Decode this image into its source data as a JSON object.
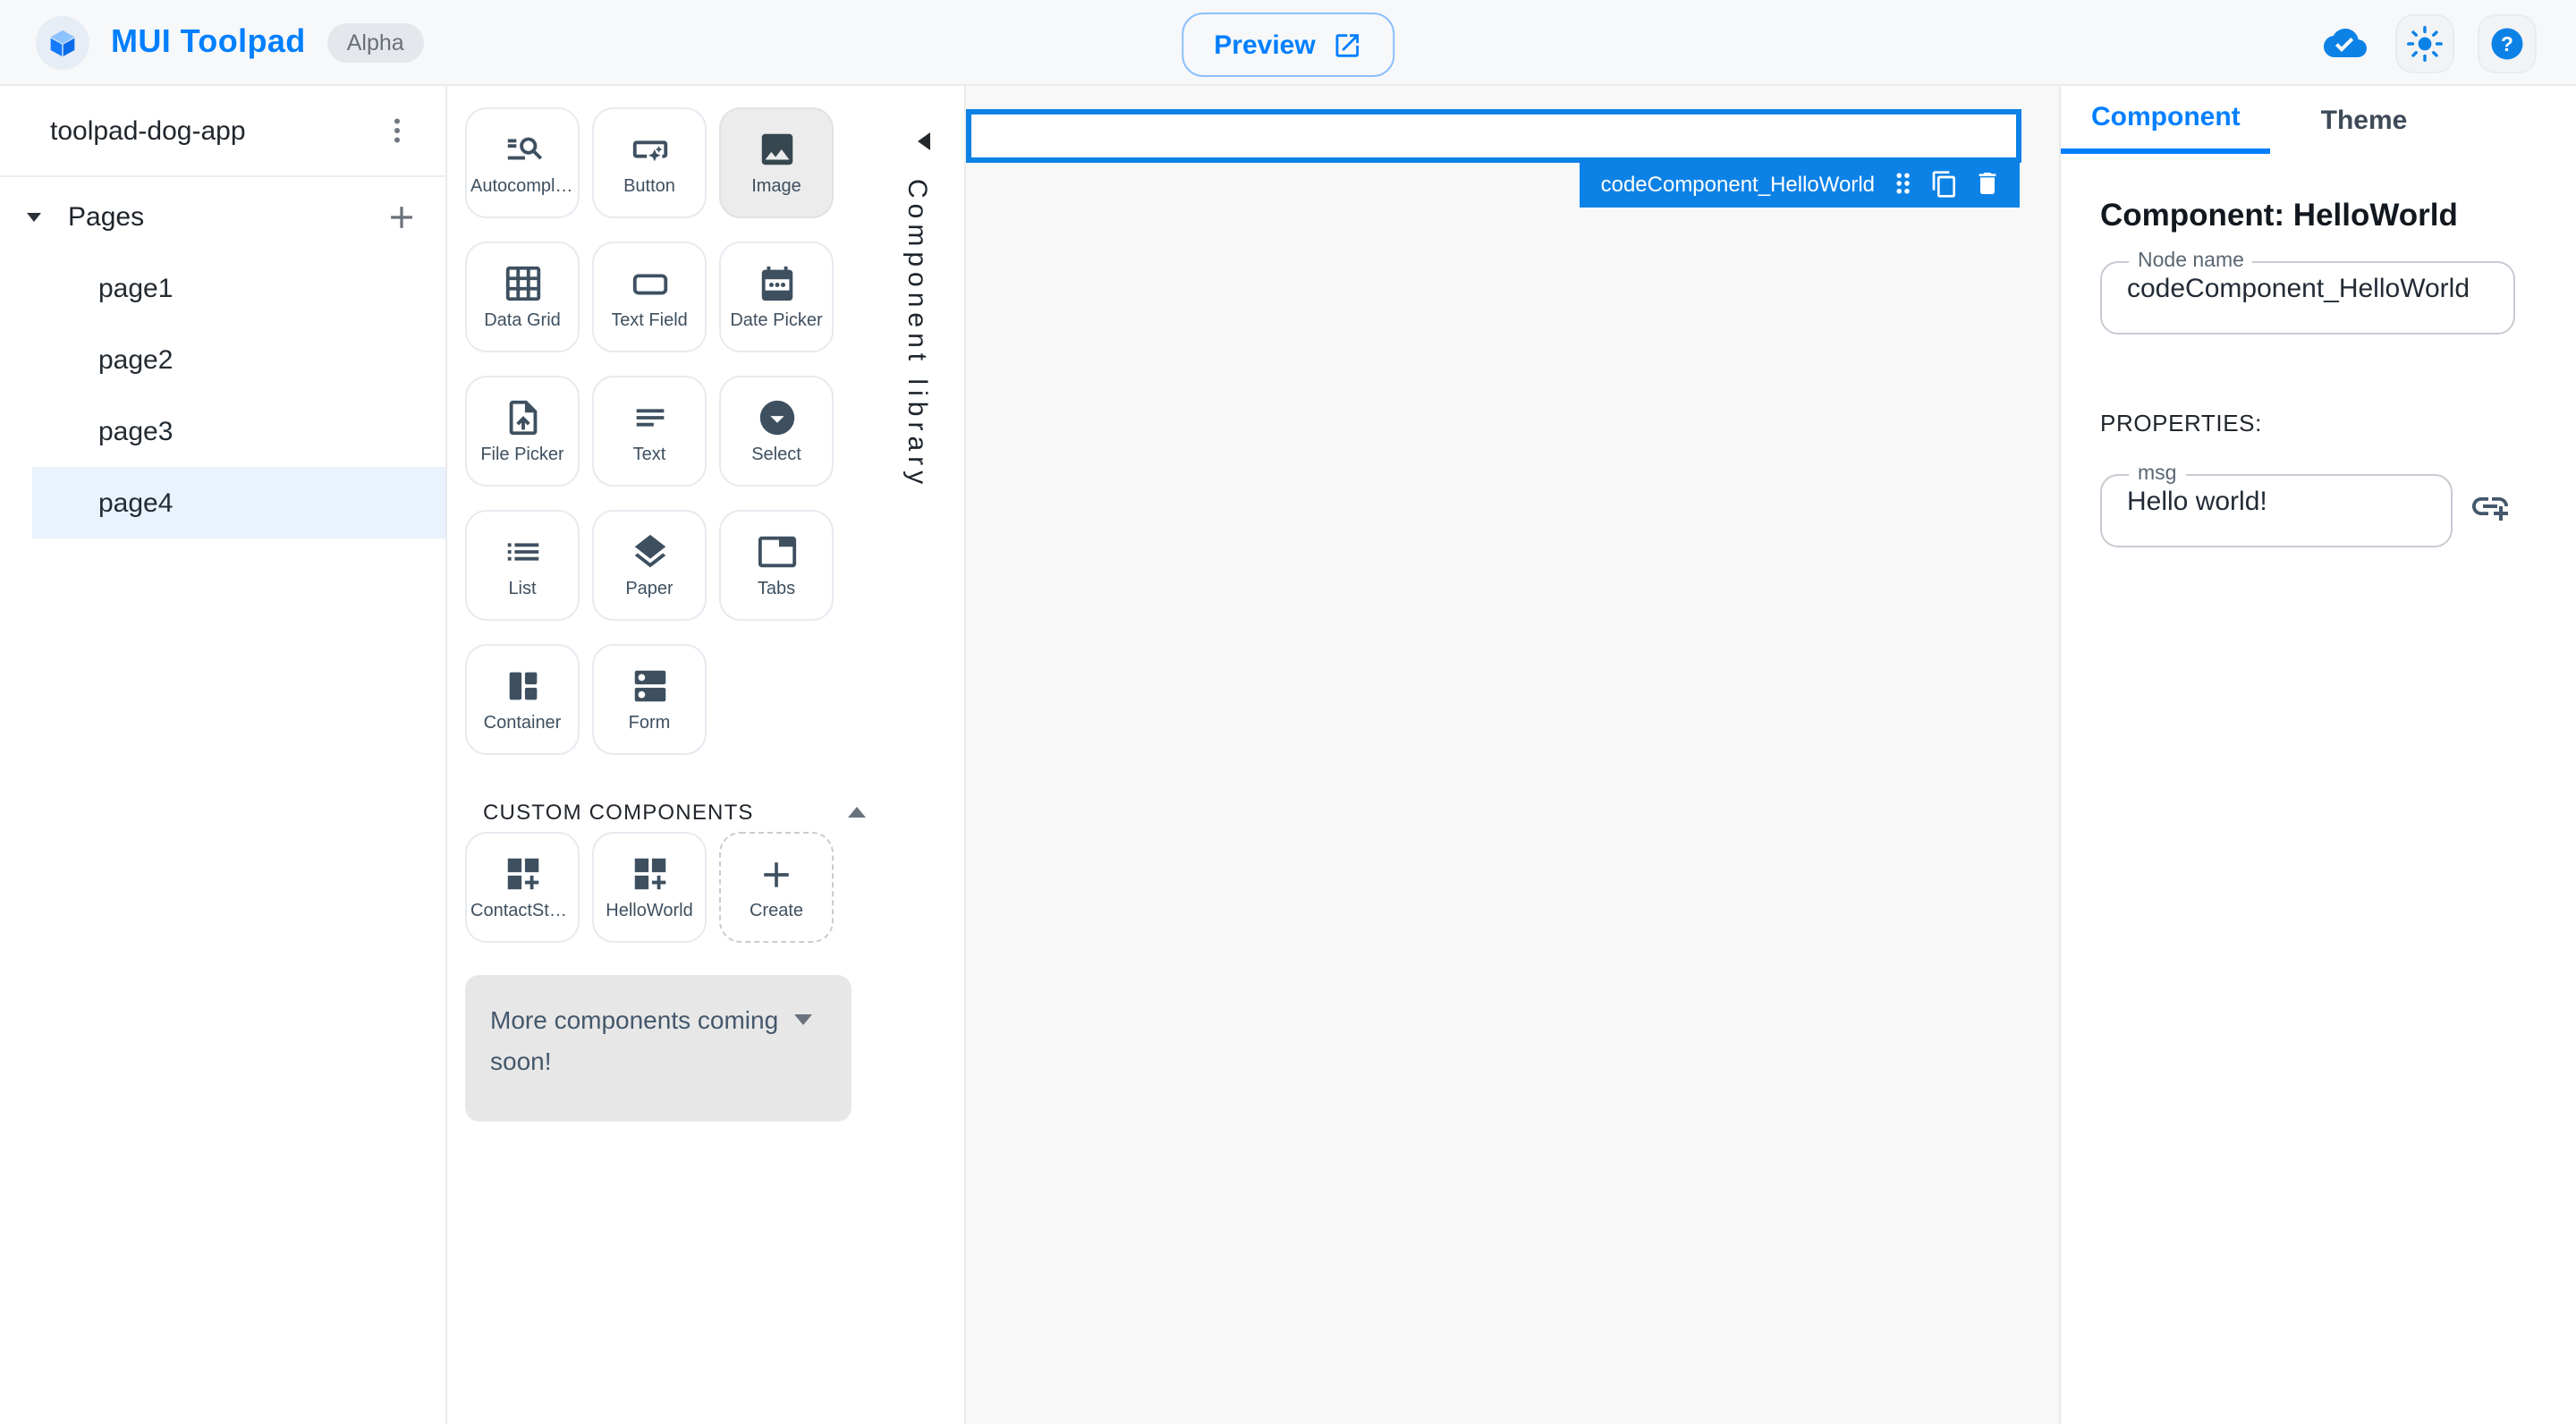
{
  "header": {
    "app_title": "MUI Toolpad",
    "badge": "Alpha",
    "preview_label": "Preview"
  },
  "sidebar": {
    "app_name": "toolpad-dog-app",
    "pages_label": "Pages",
    "pages": [
      {
        "label": "page1",
        "selected": false
      },
      {
        "label": "page2",
        "selected": false
      },
      {
        "label": "page3",
        "selected": false
      },
      {
        "label": "page4",
        "selected": true
      }
    ]
  },
  "library": {
    "panel_label": "Component library",
    "components": [
      {
        "label": "Autocomplete"
      },
      {
        "label": "Button"
      },
      {
        "label": "Image",
        "selected": true
      },
      {
        "label": "Data Grid"
      },
      {
        "label": "Text Field"
      },
      {
        "label": "Date Picker"
      },
      {
        "label": "File Picker"
      },
      {
        "label": "Text"
      },
      {
        "label": "Select"
      },
      {
        "label": "List"
      },
      {
        "label": "Paper"
      },
      {
        "label": "Tabs"
      },
      {
        "label": "Container"
      },
      {
        "label": "Form"
      }
    ],
    "custom_header": "CUSTOM COMPONENTS",
    "custom_components": [
      {
        "label": "ContactSta…"
      },
      {
        "label": "HelloWorld"
      }
    ],
    "create_label": "Create",
    "coming_soon": "More components coming soon!"
  },
  "canvas": {
    "chip_label": "codeComponent_HelloWorld"
  },
  "inspector": {
    "tabs": [
      {
        "label": "Component",
        "active": true
      },
      {
        "label": "Theme",
        "active": false
      }
    ],
    "heading": "Component: HelloWorld",
    "node_name_label": "Node name",
    "node_name_value": "codeComponent_HelloWorld",
    "properties_label": "PROPERTIES:",
    "msg_label": "msg",
    "msg_value": "Hello world!"
  },
  "colors": {
    "accent": "#007FFF",
    "selection": "#0d82e6",
    "icon_slate": "#3e5060",
    "canvas_bg": "#f8f8f9"
  }
}
